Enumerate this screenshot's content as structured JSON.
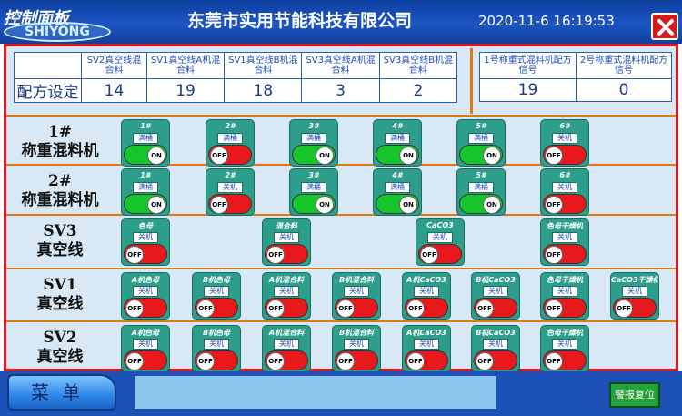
{
  "header": {
    "panel_title": "控制面板",
    "logo_text": "SHIYONG",
    "company": "东莞市实用节能科技有限公司",
    "datetime": "2020-11-6  16:19:53",
    "close_icon": "close-icon"
  },
  "recipe": {
    "row_label": "配方设定",
    "left": [
      {
        "header": "SV2真空线混合料",
        "value": "14"
      },
      {
        "header": "SV1真空线A机混合料",
        "value": "19"
      },
      {
        "header": "SV1真空线B机混合料",
        "value": "18"
      },
      {
        "header": "SV3真空线A机混合料",
        "value": "3"
      },
      {
        "header": "SV3真空线B机混合料",
        "value": "2"
      }
    ],
    "right": [
      {
        "header": "1号称重式混料机配方信号",
        "value": "19"
      },
      {
        "header": "2号称重式混料机配方信号",
        "value": "0"
      }
    ]
  },
  "rows": [
    {
      "label": "1#称重混料机",
      "switches": [
        {
          "name": "1#",
          "state_label": "满桶",
          "on": true,
          "knob": "ON"
        },
        {
          "name": "2#",
          "state_label": "满桶",
          "on": false,
          "knob": "OFF"
        },
        {
          "name": "3#",
          "state_label": "满桶",
          "on": true,
          "knob": "ON"
        },
        {
          "name": "4#",
          "state_label": "满桶",
          "on": true,
          "knob": "ON"
        },
        {
          "name": "5#",
          "state_label": "满桶",
          "on": true,
          "knob": "ON"
        },
        {
          "name": "6#",
          "state_label": "关机",
          "on": false,
          "knob": "OFF"
        }
      ]
    },
    {
      "label": "2#称重混料机",
      "switches": [
        {
          "name": "1#",
          "state_label": "满桶",
          "on": true,
          "knob": "ON"
        },
        {
          "name": "2#",
          "state_label": "关机",
          "on": false,
          "knob": "OFF"
        },
        {
          "name": "3#",
          "state_label": "满桶",
          "on": true,
          "knob": "ON"
        },
        {
          "name": "4#",
          "state_label": "满桶",
          "on": true,
          "knob": "ON"
        },
        {
          "name": "5#",
          "state_label": "满桶",
          "on": true,
          "knob": "ON"
        },
        {
          "name": "6#",
          "state_label": "关机",
          "on": false,
          "knob": "OFF"
        }
      ]
    },
    {
      "label": "SV3真空线",
      "switches": [
        {
          "name": "色母",
          "state_label": "关机",
          "on": false,
          "knob": "OFF"
        },
        {
          "name": "混合料",
          "state_label": "关机",
          "on": false,
          "knob": "OFF"
        },
        {
          "name": "CaCO3",
          "state_label": "关机",
          "on": false,
          "knob": "OFF"
        },
        {
          "name": "色母干燥机",
          "state_label": "关机",
          "on": false,
          "knob": "OFF"
        }
      ]
    },
    {
      "label": "SV1真空线",
      "switches": [
        {
          "name": "A机色母",
          "state_label": "关机",
          "on": false,
          "knob": "OFF"
        },
        {
          "name": "B机色母",
          "state_label": "关机",
          "on": false,
          "knob": "OFF"
        },
        {
          "name": "A机混合料",
          "state_label": "关机",
          "on": false,
          "knob": "OFF"
        },
        {
          "name": "B机混合料",
          "state_label": "关机",
          "on": false,
          "knob": "OFF"
        },
        {
          "name": "A机CaCO3",
          "state_label": "关机",
          "on": false,
          "knob": "OFF"
        },
        {
          "name": "B机CaCO3",
          "state_label": "关机",
          "on": false,
          "knob": "OFF"
        },
        {
          "name": "色母干燥机",
          "state_label": "关机",
          "on": false,
          "knob": "OFF"
        },
        {
          "name": "CaCO3干燥机",
          "state_label": "关机",
          "on": false,
          "knob": "OFF"
        }
      ]
    },
    {
      "label": "SV2真空线",
      "switches": [
        {
          "name": "A机色母",
          "state_label": "关机",
          "on": false,
          "knob": "OFF"
        },
        {
          "name": "B机色母",
          "state_label": "关机",
          "on": false,
          "knob": "OFF"
        },
        {
          "name": "A机混合料",
          "state_label": "关机",
          "on": false,
          "knob": "OFF"
        },
        {
          "name": "B机混合料",
          "state_label": "关机",
          "on": false,
          "knob": "OFF"
        },
        {
          "name": "A机CaCO3",
          "state_label": "关机",
          "on": false,
          "knob": "OFF"
        },
        {
          "name": "B机CaCO3",
          "state_label": "关机",
          "on": false,
          "knob": "OFF"
        },
        {
          "name": "色母干燥机",
          "state_label": "关机",
          "on": false,
          "knob": "OFF"
        }
      ]
    }
  ],
  "footer": {
    "menu_label": "菜单",
    "reset_label": "警报复位"
  },
  "colors": {
    "header_bg": "#1d55c4",
    "frame_border": "#e0151b",
    "switch_on": "#17c42a",
    "switch_off": "#e7191d",
    "widget_bg": "#2d9d8c"
  }
}
